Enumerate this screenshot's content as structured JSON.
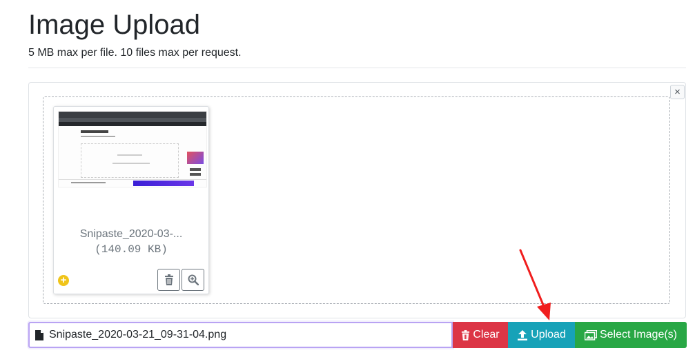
{
  "page": {
    "title": "Image Upload",
    "subtitle": "5 MB max per file. 10 files max per request."
  },
  "panel": {
    "close_label": "×"
  },
  "thumbnail": {
    "file_name": "Snipaste_2020-03-...",
    "file_size": "(140.09 KB)",
    "status_icon": "plus-circle-icon",
    "remove_icon": "trash-icon",
    "zoom_icon": "zoom-in-icon"
  },
  "toolbar": {
    "file_value": "Snipaste_2020-03-21_09-31-04.png",
    "clear_label": "Clear",
    "upload_label": "Upload",
    "select_label": "Select Image(s)"
  },
  "colors": {
    "clear": "#dc3545",
    "upload": "#17a2b8",
    "select": "#28a745",
    "annotation_arrow": "#f01e1e"
  }
}
